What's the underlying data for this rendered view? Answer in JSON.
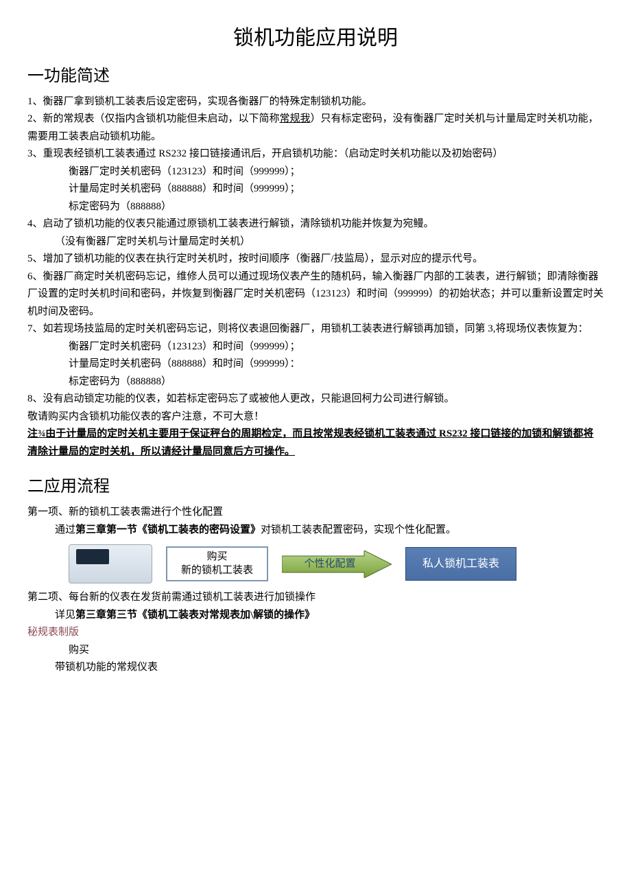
{
  "title": "锁机功能应用说明",
  "section1": {
    "heading": "一功能简述",
    "items": {
      "i1": "1、衡器厂拿到锁机工装表后设定密码，实现各衡器厂的特殊定制锁机功能。",
      "i2a": "2、新的常规表（仅指内含锁机功能但未启动，以下简称",
      "i2u": "常规我",
      "i2b": "）只有标定密码，没有衡器厂定时关机与计量局定时关机功能，需要用工装表启动锁机功能。",
      "i3": "3、重现表经锁机工装表通过 RS232 接口链接通讯后，开启锁机功能：（启动定时关机功能以及初始密码）",
      "i3a": "衡器厂定时关机密码（123123）和时间（999999）；",
      "i3b": "计量局定时关机密码（888888）和时间（999999）；",
      "i3c": "标定密码为（888888）",
      "i4": "4、启动了锁机功能的仪表只能通过原锁机工装表进行解锁，清除锁机功能并恢复为宛鳗。",
      "i4a": "（没有衡器厂定时关机与计量局定时关机）",
      "i5": "5、增加了锁机功能的仪表在执行定时关机时，按时间顺序（衡器厂/技监局），显示对应的提示代号。",
      "i6": "6、衡器厂商定时关机密码忘记，维修人员可以通过现场仪表产生的随机码，输入衡器厂内部的工装表，进行解锁；即清除衡器厂设置的定时关机时间和密码，并恢复到衡器厂定时关机密码（123123）和时间（999999）的初始状态；并可以重新设置定时关机时间及密码。",
      "i7": "7、如若现场技监局的定时关机密码忘记，则将仪表退回衡器厂，用锁机工装表进行解锁再加锁，同第 3,将现场仪表恢复为：",
      "i7a": "衡器厂定时关机密码（123123）和时间（999999）；",
      "i7b": "计量局定时关机密码（888888）和时间（999999）：",
      "i7c": "标定密码为（888888）",
      "i8": "8、没有启动锁定功能的仪表，如若标定密码忘了或被他人更改，只能退回柯力公司进行解锁。",
      "caution": "敬请购买内含锁机功能仪表的客户注意，不可大意！",
      "note": "注¾由于计量局的定时关机主要用于保证秤台的周期检定，而且按常规表经锁机工装表通过 RS232 接口链接的加锁和解锁都将清除计量局的定时关机，所以请经计量局同意后方可操作。"
    }
  },
  "section2": {
    "heading": "二应用流程",
    "item1_a": "第一项、新的锁机工装表需进行个性化配置",
    "item1_b_pre": "通过",
    "item1_b_bold": "第三章第一节《锁机工装表的密码设置》",
    "item1_b_post": "对锁机工装表配置密码，实现个性化配置。",
    "flow1": {
      "box1_l1": "购买",
      "box1_l2": "新的锁机工装表",
      "arrow_label": "个性化配置",
      "box2": "私人锁机工装表"
    },
    "item2_a": "第二项、每台新的仪表在发货前需通过锁机工装表进行加锁操作",
    "item2_b_pre": "详见",
    "item2_b_bold": "第三章第三节《锁机工装表对常规表加\\解锁的操作》",
    "reddish": "秘规表制版",
    "item2_c1": "购买",
    "item2_c2": "带锁机功能的常规仪表"
  }
}
